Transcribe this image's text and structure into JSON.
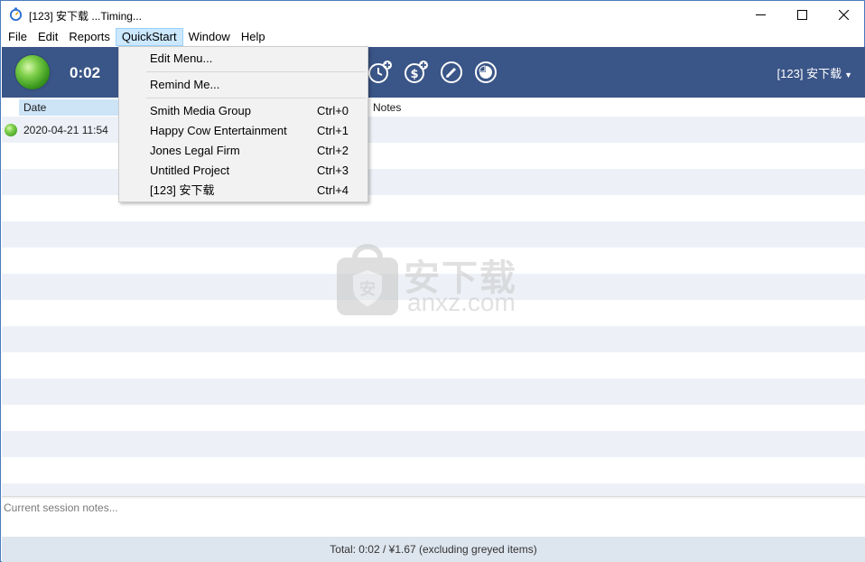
{
  "window": {
    "title": "[123] 安下载 ...Timing..."
  },
  "menubar": {
    "items": [
      {
        "label": "File"
      },
      {
        "label": "Edit"
      },
      {
        "label": "Reports"
      },
      {
        "label": "QuickStart",
        "active": true
      },
      {
        "label": "Window"
      },
      {
        "label": "Help"
      }
    ]
  },
  "toolbar": {
    "timer": "0:02",
    "project": "[123] 安下载",
    "icons": [
      "add-time-icon",
      "add-expense-icon",
      "edit-icon",
      "report-icon"
    ]
  },
  "quickstart_menu": {
    "edit_menu": "Edit Menu...",
    "remind_me": "Remind Me...",
    "projects": [
      {
        "label": "Smith Media Group",
        "shortcut": "Ctrl+0"
      },
      {
        "label": "Happy Cow Entertainment",
        "shortcut": "Ctrl+1"
      },
      {
        "label": "Jones Legal Firm",
        "shortcut": "Ctrl+2"
      },
      {
        "label": "Untitled Project",
        "shortcut": "Ctrl+3"
      },
      {
        "label": "[123] 安下载",
        "shortcut": "Ctrl+4"
      }
    ]
  },
  "table": {
    "columns": {
      "date": "Date",
      "notes": "Notes"
    },
    "rows": [
      {
        "date": "2020-04-21   11:54",
        "notes": ""
      }
    ]
  },
  "watermark": {
    "cn": "安下载",
    "en": "anxz.com"
  },
  "notes": {
    "placeholder": "Current session notes..."
  },
  "status": {
    "total": "Total: 0:02 / ¥1.67 (excluding greyed items)"
  },
  "colors": {
    "toolbar_bg": "#3a5587",
    "menu_active": "#cce8ff",
    "row_alt": "#edf1f7",
    "statusbar_bg": "#dde5ee"
  }
}
